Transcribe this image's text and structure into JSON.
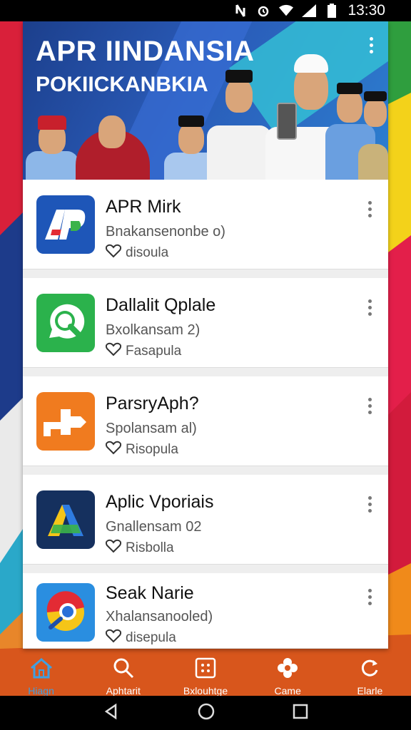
{
  "status_bar": {
    "time": "13:30"
  },
  "banner": {
    "title": "APR IINDANSIA",
    "subtitle": "POKIICKANBKIA"
  },
  "apps": [
    {
      "name": "APR Mirk",
      "subtitle": "Bnakansenonbe o)",
      "fav_label": "disoula",
      "icon": "apr-logo-icon",
      "icon_color": "#1e56b8"
    },
    {
      "name": "Dallalit Qplale",
      "subtitle": "Bxolkansam 2)",
      "fav_label": "Fasapula",
      "icon": "magnifier-chat-icon",
      "icon_color": "#2bb24c"
    },
    {
      "name": "ParsryAph?",
      "subtitle": "Spolansam al)",
      "fav_label": "Risopula",
      "icon": "arrow-puzzle-icon",
      "icon_color": "#f07b1f"
    },
    {
      "name": "Aplic Vporiais",
      "subtitle": "Gnallensam 02",
      "fav_label": "Risbolla",
      "icon": "triangle-a-icon",
      "icon_color": "#15305e"
    },
    {
      "name": "Seak Narie",
      "subtitle": "Xhalansanooled)",
      "fav_label": "disepula",
      "icon": "swirl-browser-icon",
      "icon_color": "#2a8ee0"
    }
  ],
  "bottom_nav": [
    {
      "label": "Hiagn",
      "icon": "home-icon",
      "active": true
    },
    {
      "label": "Aphtarit",
      "icon": "search-icon",
      "active": false
    },
    {
      "label": "Bxlouhtge",
      "icon": "grid-icon",
      "active": false
    },
    {
      "label": "Came",
      "icon": "flower-icon",
      "active": false
    },
    {
      "label": "Elarle",
      "icon": "refresh-icon",
      "active": false
    }
  ],
  "colors": {
    "accent": "#3fa0e0",
    "banner_blue": "#1c3f8c"
  }
}
